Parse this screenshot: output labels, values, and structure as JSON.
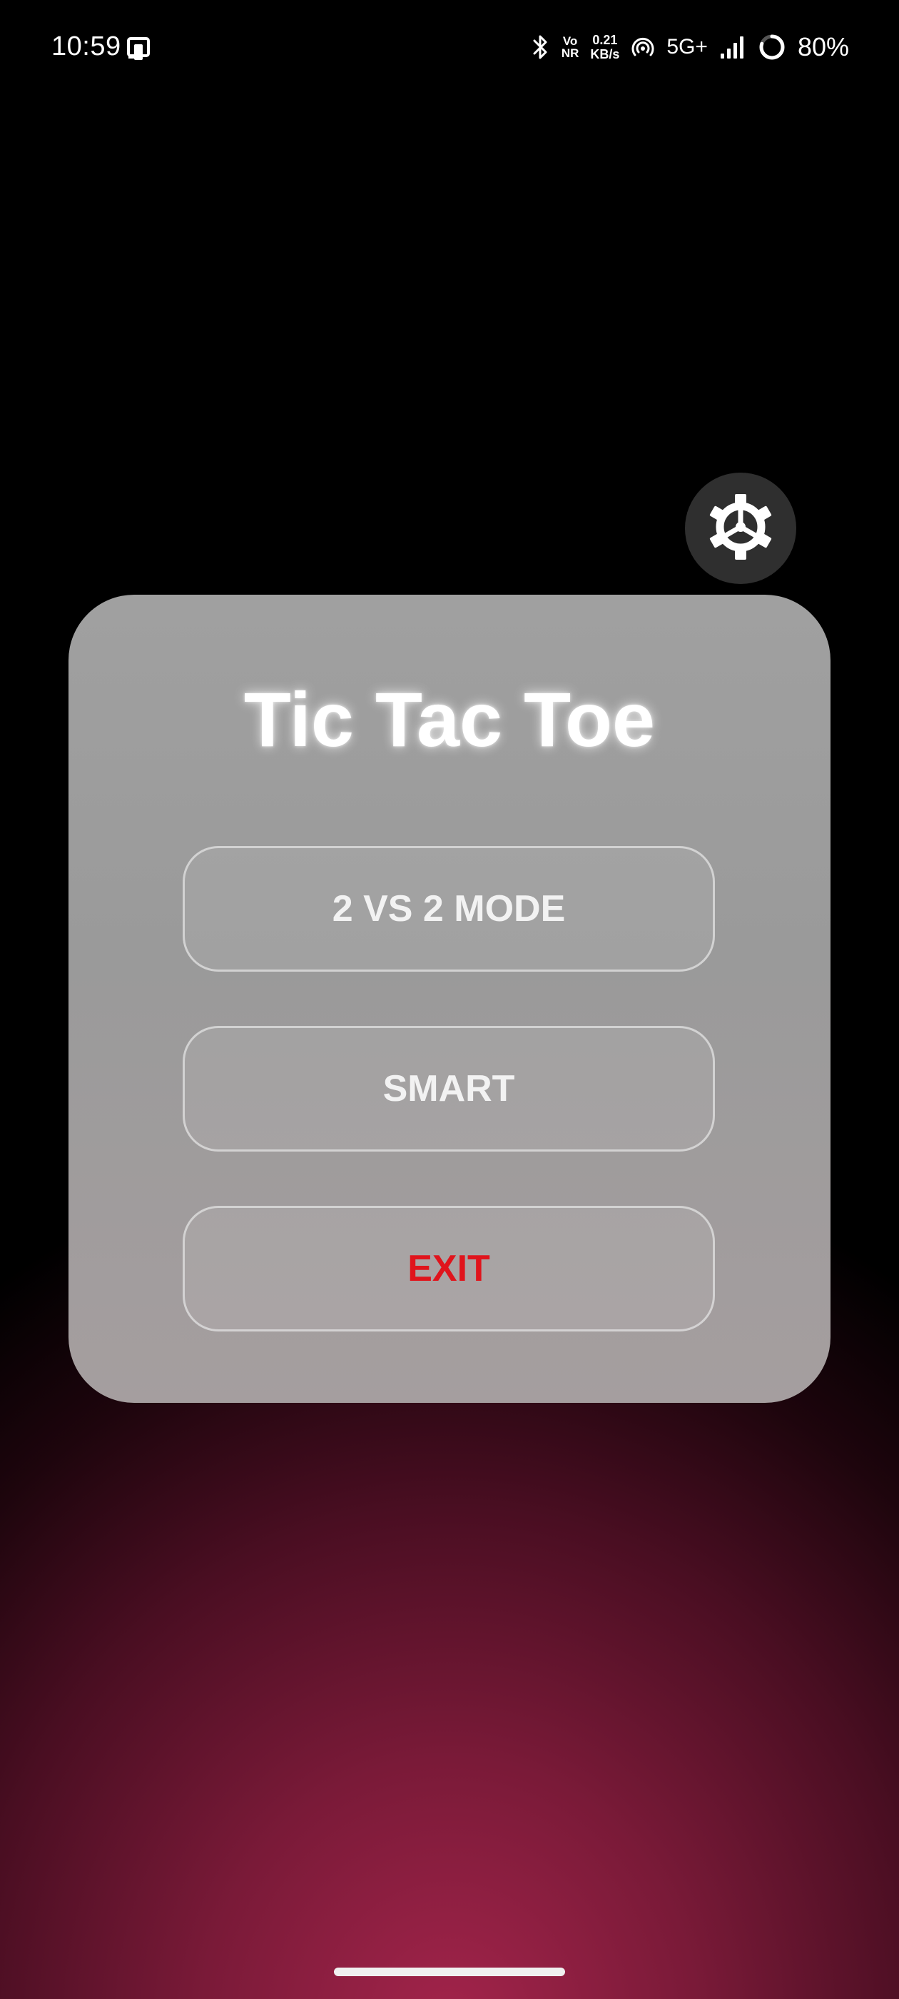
{
  "status_bar": {
    "time": "10:59",
    "vonr_top": "Vo",
    "vonr_bottom": "NR",
    "speed_value": "0.21",
    "speed_unit": "KB/s",
    "network_type": "5G+",
    "battery": "80%",
    "battery_level": 0.8,
    "icons": [
      "notification-app-icon",
      "bluetooth-icon",
      "hotspot-icon",
      "signal-icon",
      "battery-ring-icon"
    ]
  },
  "settings": {
    "icon": "gear-icon",
    "background_color": "#2f2f2f"
  },
  "menu": {
    "title": "Tic Tac Toe",
    "buttons": {
      "mode": "2 VS 2 MODE",
      "smart": "SMART",
      "exit": "EXIT"
    },
    "exit_color": "#e0141c"
  },
  "colors": {
    "background_glow": "#a3244b",
    "card": "#a0a0a0"
  }
}
